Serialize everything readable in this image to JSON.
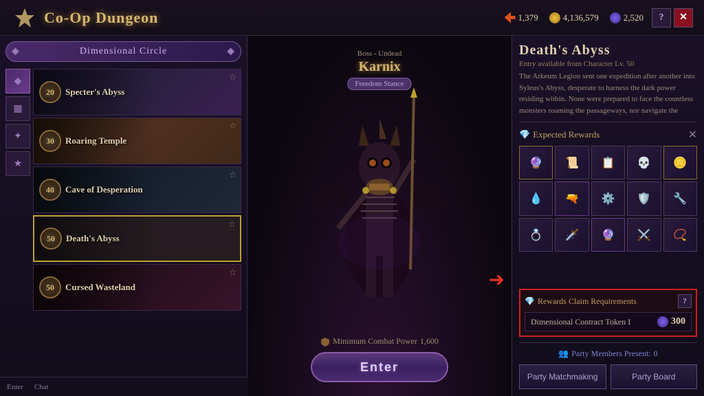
{
  "header": {
    "title": "Co-Op Dungeon",
    "section": "Dimensional Circle",
    "resources": [
      {
        "icon": "arrow-icon",
        "value": "1,379"
      },
      {
        "icon": "coin-icon",
        "value": "4,136,579"
      },
      {
        "icon": "gem-icon",
        "value": "2,520"
      }
    ],
    "buttons": [
      {
        "label": "?",
        "name": "help-button"
      },
      {
        "label": "✕",
        "name": "close-button"
      }
    ]
  },
  "nav_icons": [
    {
      "icon": "diamond-icon",
      "active": true
    },
    {
      "icon": "prison-icon",
      "active": false
    },
    {
      "icon": "plus-icon",
      "active": false
    },
    {
      "icon": "star-icon",
      "active": false
    }
  ],
  "dungeons": [
    {
      "level": "20",
      "name": "Specter's Abyss",
      "bg_class": "dbg-specter",
      "selected": false
    },
    {
      "level": "30",
      "name": "Roaring Temple",
      "bg_class": "dbg-temple",
      "selected": false
    },
    {
      "level": "40",
      "name": "Cave of Desperation",
      "bg_class": "dbg-cave",
      "selected": false
    },
    {
      "level": "50",
      "name": "Death's Abyss",
      "bg_class": "dbg-abyss",
      "selected": true
    },
    {
      "level": "50",
      "name": "Cursed Wasteland",
      "bg_class": "dbg-wasteland",
      "selected": false
    }
  ],
  "boss": {
    "type": "Boss - Undead",
    "name": "Karnix",
    "stance": "Freedom Stance"
  },
  "combat": {
    "min_power_label": "Minimum Combat Power",
    "min_power_value": "1,600"
  },
  "enter_button": "Enter",
  "detail": {
    "title": "Death's Abyss",
    "subtitle": "Entry available from Character Lv. 50",
    "description": "The Arkeum Legion sent one expedition after another into Syleus's Abyss, desperate to harness the dark power residing within. None were prepared to face the countless monsters roaming the passageways, nor navigate the"
  },
  "rewards": {
    "label": "Expected Rewards",
    "items": [
      {
        "icon": "🔮",
        "border": "gold-border"
      },
      {
        "icon": "📜",
        "border": ""
      },
      {
        "icon": "📜",
        "border": ""
      },
      {
        "icon": "💀",
        "border": ""
      },
      {
        "icon": "🪙",
        "border": "gold-border"
      },
      {
        "icon": "💧",
        "border": ""
      },
      {
        "icon": "🔫",
        "border": "purple-border"
      },
      {
        "icon": "⚙️",
        "border": ""
      },
      {
        "icon": "🛡️",
        "border": ""
      },
      {
        "icon": "🔧",
        "border": ""
      },
      {
        "icon": "💍",
        "border": ""
      },
      {
        "icon": "🗡️",
        "border": ""
      },
      {
        "icon": "🔮",
        "border": "purple-border"
      },
      {
        "icon": "⚔️",
        "border": ""
      },
      {
        "icon": "📿",
        "border": ""
      }
    ]
  },
  "claim": {
    "header": "Rewards Claim Requirements",
    "item_name": "Dimensional Contract Token I",
    "cost": "300"
  },
  "party": {
    "members_label": "Party Members Present:",
    "members_count": "0",
    "buttons": [
      {
        "label": "Party Matchmaking",
        "name": "party-matchmaking-button"
      },
      {
        "label": "Party Board",
        "name": "party-board-button"
      }
    ]
  },
  "bottom": {
    "buttons": [
      "Enter",
      "Chat"
    ]
  }
}
